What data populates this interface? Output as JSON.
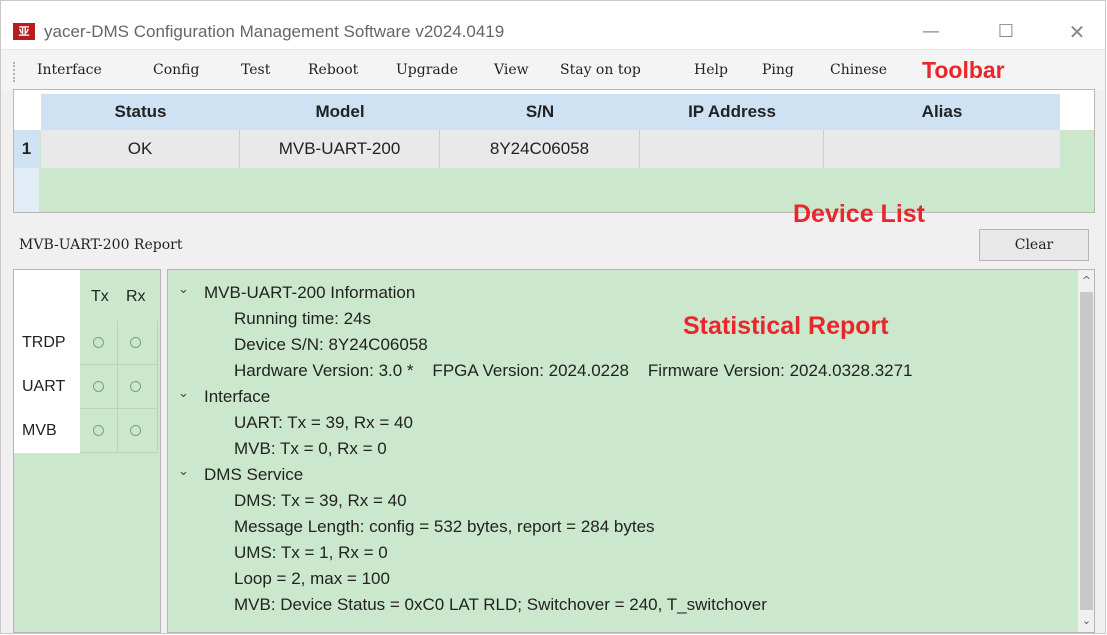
{
  "window": {
    "icon_text": "亚",
    "title": "yacer-DMS Configuration Management Software v2024.0419",
    "min_glyph": "—",
    "max_glyph": "☐",
    "close_glyph": "✕"
  },
  "toolbar": {
    "items": [
      "Interface",
      "Config",
      "Test",
      "Reboot",
      "Upgrade",
      "View",
      "Stay on top",
      "Help",
      "Ping",
      "Chinese"
    ],
    "annotation": "Toolbar"
  },
  "device_list": {
    "columns": [
      "Status",
      "Model",
      "S/N",
      "IP Address",
      "Alias"
    ],
    "rows": [
      {
        "index": "1",
        "status": "OK",
        "model": "MVB-UART-200",
        "sn": "8Y24C06058",
        "ip": "",
        "alias": ""
      }
    ],
    "annotation": "Device List"
  },
  "report": {
    "title": "MVB-UART-200 Report",
    "clear_label": "Clear",
    "annotation": "Statistical Report",
    "sections": [
      {
        "heading": "MVB-UART-200 Information",
        "lines": [
          "Running time: 24s",
          "Device S/N: 8Y24C06058",
          "Hardware Version: 3.0 *    FPGA Version: 2024.0228    Firmware Version: 2024.0328.3271"
        ]
      },
      {
        "heading": "Interface",
        "lines": [
          "UART: Tx = 39, Rx = 40",
          "MVB: Tx = 0, Rx = 0"
        ]
      },
      {
        "heading": "DMS Service",
        "lines": [
          "DMS: Tx = 39, Rx = 40",
          "Message Length: config = 532 bytes, report = 284 bytes",
          "UMS: Tx = 1, Rx = 0",
          "Loop = 2, max = 100",
          "MVB: Device Status = 0xC0 LAT RLD; Switchover = 240, T_switchover"
        ]
      }
    ],
    "chevron_glyph": "⌄"
  },
  "io_panel": {
    "headers": [
      "Tx",
      "Rx"
    ],
    "rows": [
      "TRDP",
      "UART",
      "MVB"
    ]
  },
  "scrollbar": {
    "up_glyph": "^",
    "down_glyph": "⌄"
  }
}
